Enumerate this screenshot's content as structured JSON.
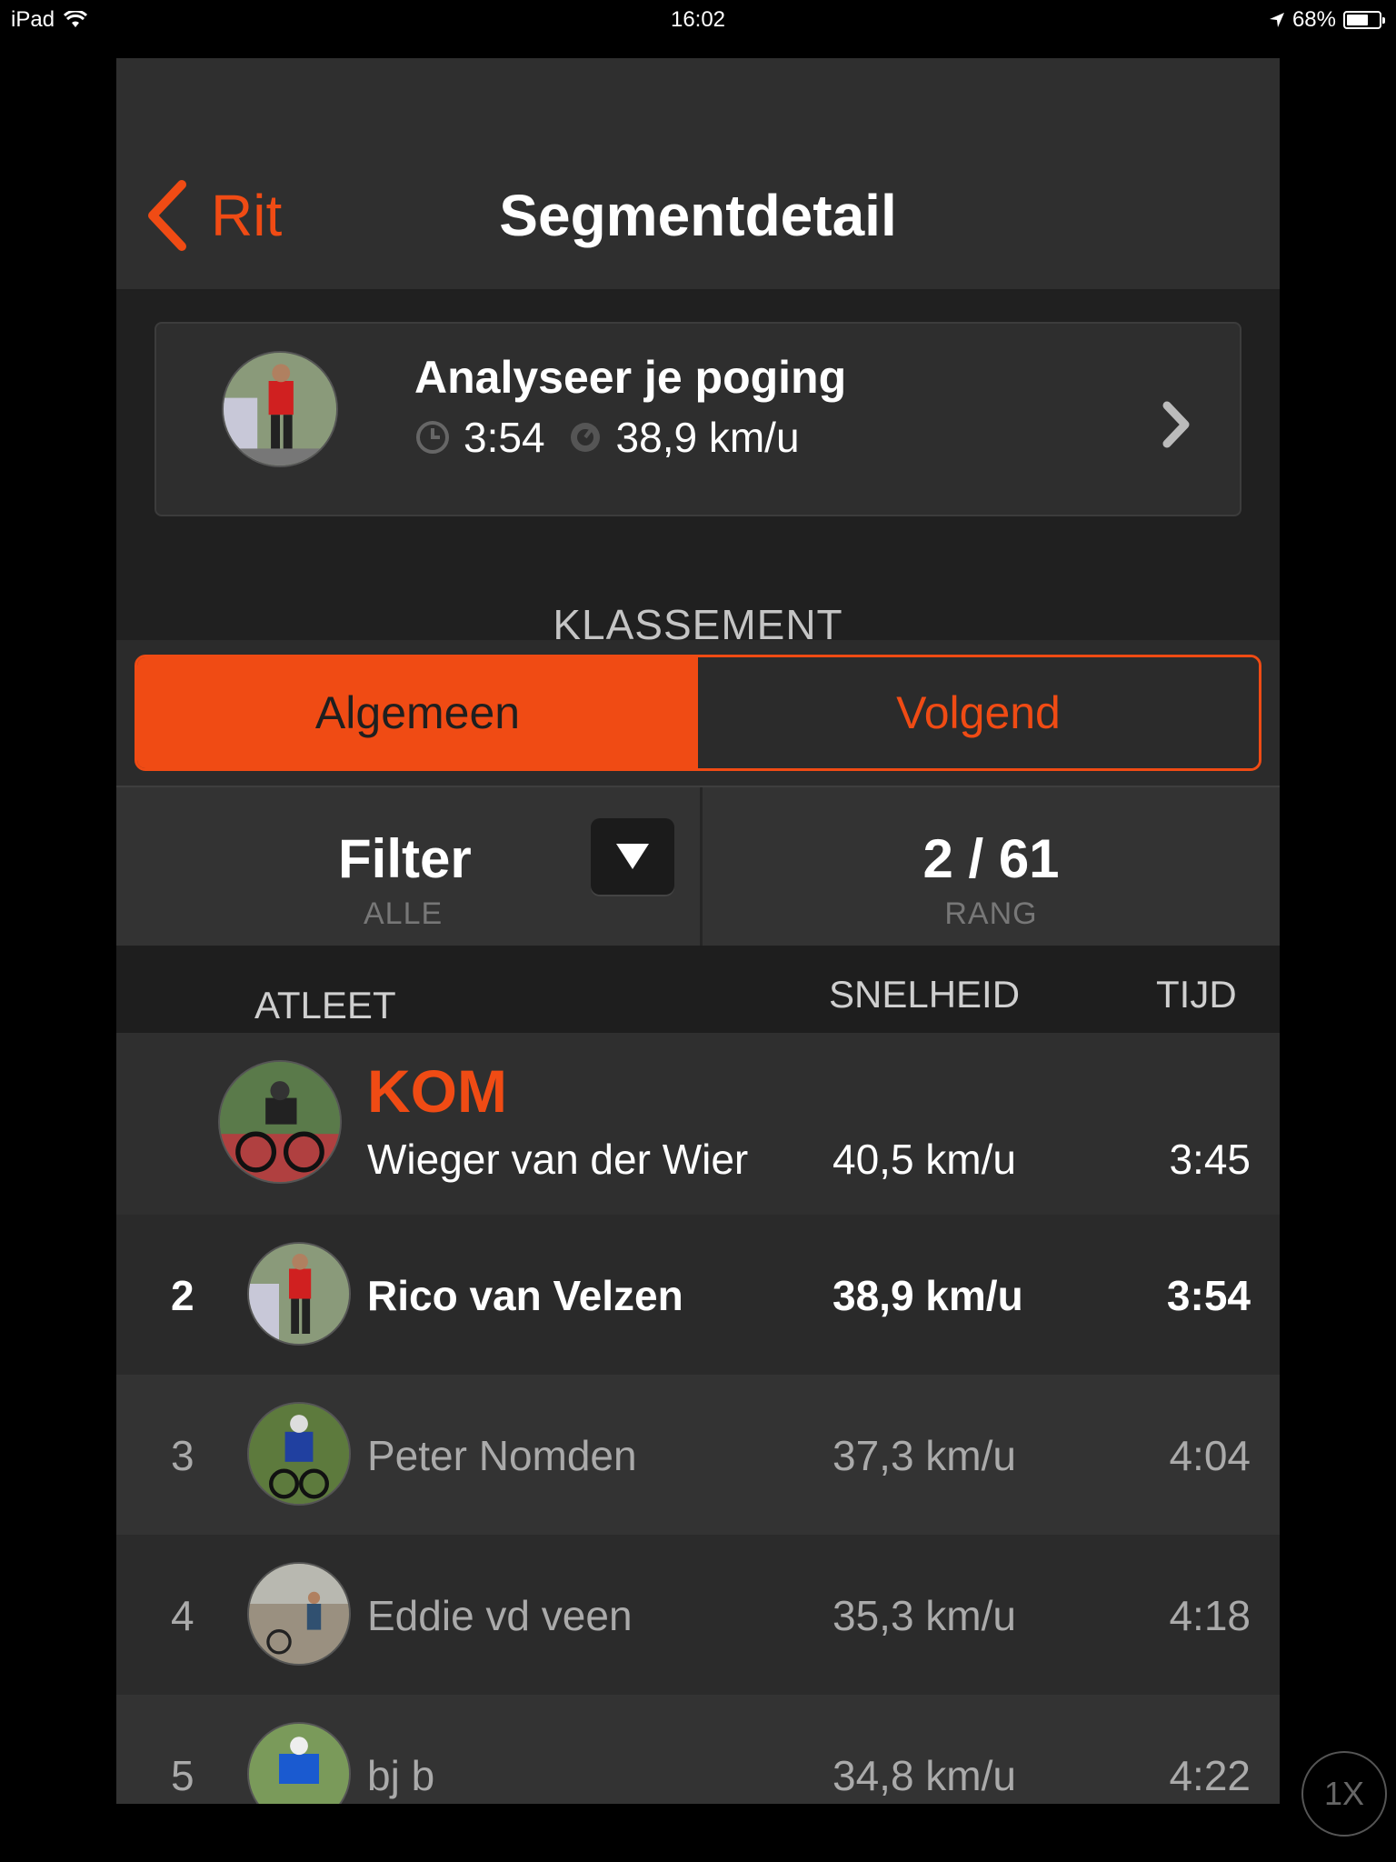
{
  "status_bar": {
    "device": "iPad",
    "time": "16:02",
    "battery": "68%",
    "battery_level": 0.68
  },
  "nav": {
    "back_label": "Rit",
    "title": "Segmentdetail"
  },
  "attempt": {
    "title": "Analyseer je poging",
    "time": "3:54",
    "speed": "38,9 km/u"
  },
  "leaderboard": {
    "section_label": "KLASSEMENT",
    "tabs": [
      {
        "label": "Algemeen",
        "active": true
      },
      {
        "label": "Volgend",
        "active": false
      }
    ],
    "filter": {
      "label": "Filter",
      "value": "ALLE"
    },
    "rank": {
      "value": "2 / 61",
      "label": "RANG"
    },
    "columns": {
      "athlete": "ATLEET",
      "speed": "SNELHEID",
      "time": "TIJD"
    },
    "kom": {
      "label": "KOM",
      "name": "Wieger van der Wier",
      "speed": "40,5 km/u",
      "time": "3:45"
    },
    "rows": [
      {
        "rank": "2",
        "name": "Rico van Velzen",
        "speed": "38,9 km/u",
        "time": "3:54"
      },
      {
        "rank": "3",
        "name": "Peter Nomden",
        "speed": "37,3 km/u",
        "time": "4:04"
      },
      {
        "rank": "4",
        "name": "Eddie vd veen",
        "speed": "35,3 km/u",
        "time": "4:18"
      },
      {
        "rank": "5",
        "name": "bj b",
        "speed": "34,8 km/u",
        "time": "4:22"
      }
    ]
  },
  "zoom_button": "1X",
  "colors": {
    "accent": "#f04b14",
    "background": "#2b2b2b"
  }
}
